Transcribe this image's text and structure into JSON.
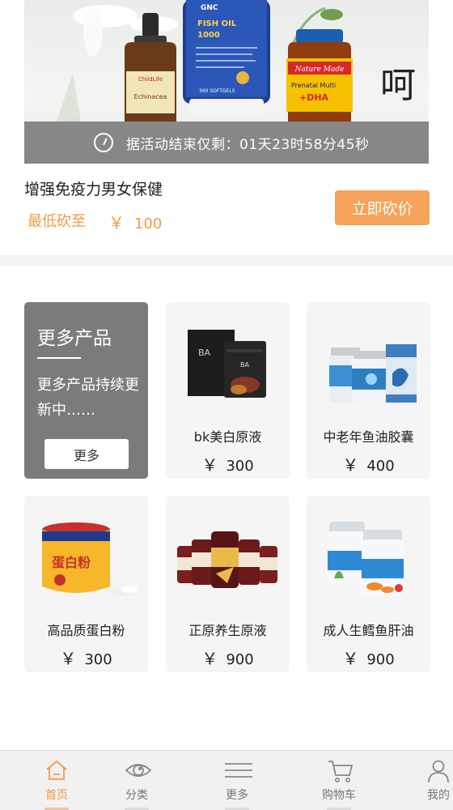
{
  "promo": {
    "countdown_text": "据活动结束仅剩：01天23时58分45秒",
    "title": "增强免疫力男女保健",
    "price_label": "最低砍至",
    "currency": "￥",
    "price": "100",
    "bargain_button": "立即砍价",
    "banner_texts": {
      "left_bottle": "Echinacea",
      "left_brand": "ChildLife",
      "mid_brand": "GNC",
      "mid_name": "FISH OIL",
      "mid_dose": "1000",
      "mid_count": "360 SOFTGELS",
      "right_brand": "Nature Made",
      "right_name": "Prenatal Multi",
      "right_dha": "+DHA",
      "side_script": "呵"
    }
  },
  "more_card": {
    "title": "更多产品",
    "desc": "更多产品持续更新中……",
    "button": "更多"
  },
  "products": [
    {
      "name": "bk美白原液",
      "currency": "￥",
      "price": "300"
    },
    {
      "name": "中老年鱼油胶囊",
      "currency": "￥",
      "price": "400"
    },
    {
      "name": "高品质蛋白粉",
      "currency": "￥",
      "price": "300"
    },
    {
      "name": "正原养生原液",
      "currency": "￥",
      "price": "900"
    },
    {
      "name": "成人生鳕鱼肝油",
      "currency": "￥",
      "price": "900"
    }
  ],
  "tabbar": [
    {
      "label": "首页",
      "icon": "home-icon",
      "active": true
    },
    {
      "label": "分类",
      "icon": "eye-icon",
      "active": false
    },
    {
      "label": "更多",
      "icon": "menu-icon",
      "active": false
    },
    {
      "label": "购物车",
      "icon": "cart-icon",
      "active": false
    },
    {
      "label": "我的",
      "icon": "user-icon",
      "active": false
    }
  ],
  "colors": {
    "accent": "#f39a44",
    "button": "#f5a25a",
    "more_card": "#7b7b7b"
  }
}
